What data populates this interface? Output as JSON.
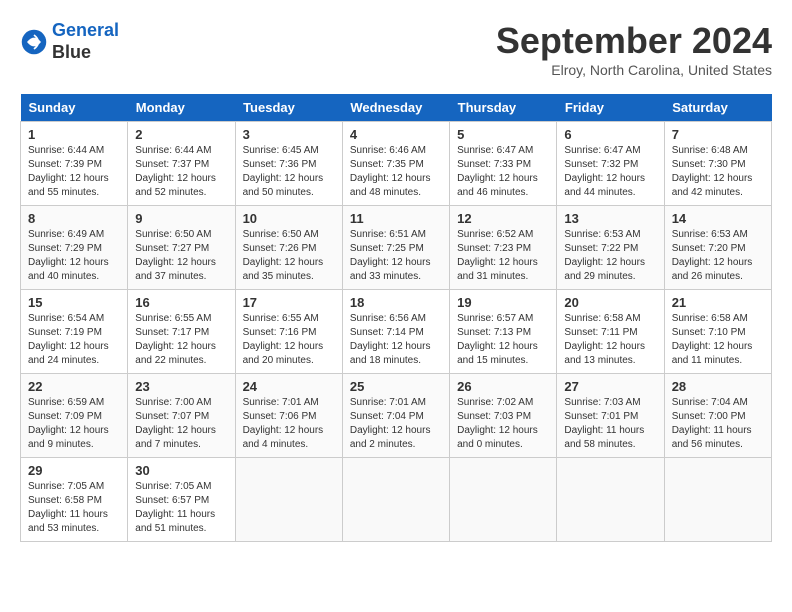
{
  "header": {
    "logo_line1": "General",
    "logo_line2": "Blue",
    "month": "September 2024",
    "location": "Elroy, North Carolina, United States"
  },
  "days_of_week": [
    "Sunday",
    "Monday",
    "Tuesday",
    "Wednesday",
    "Thursday",
    "Friday",
    "Saturday"
  ],
  "weeks": [
    [
      {
        "num": "1",
        "rise": "6:44 AM",
        "set": "7:39 PM",
        "hours": "12",
        "mins": "55"
      },
      {
        "num": "2",
        "rise": "6:44 AM",
        "set": "7:37 PM",
        "hours": "12",
        "mins": "52"
      },
      {
        "num": "3",
        "rise": "6:45 AM",
        "set": "7:36 PM",
        "hours": "12",
        "mins": "50"
      },
      {
        "num": "4",
        "rise": "6:46 AM",
        "set": "7:35 PM",
        "hours": "12",
        "mins": "48"
      },
      {
        "num": "5",
        "rise": "6:47 AM",
        "set": "7:33 PM",
        "hours": "12",
        "mins": "46"
      },
      {
        "num": "6",
        "rise": "6:47 AM",
        "set": "7:32 PM",
        "hours": "12",
        "mins": "44"
      },
      {
        "num": "7",
        "rise": "6:48 AM",
        "set": "7:30 PM",
        "hours": "12",
        "mins": "42"
      }
    ],
    [
      {
        "num": "8",
        "rise": "6:49 AM",
        "set": "7:29 PM",
        "hours": "12",
        "mins": "40"
      },
      {
        "num": "9",
        "rise": "6:50 AM",
        "set": "7:27 PM",
        "hours": "12",
        "mins": "37"
      },
      {
        "num": "10",
        "rise": "6:50 AM",
        "set": "7:26 PM",
        "hours": "12",
        "mins": "35"
      },
      {
        "num": "11",
        "rise": "6:51 AM",
        "set": "7:25 PM",
        "hours": "12",
        "mins": "33"
      },
      {
        "num": "12",
        "rise": "6:52 AM",
        "set": "7:23 PM",
        "hours": "12",
        "mins": "31"
      },
      {
        "num": "13",
        "rise": "6:53 AM",
        "set": "7:22 PM",
        "hours": "12",
        "mins": "29"
      },
      {
        "num": "14",
        "rise": "6:53 AM",
        "set": "7:20 PM",
        "hours": "12",
        "mins": "26"
      }
    ],
    [
      {
        "num": "15",
        "rise": "6:54 AM",
        "set": "7:19 PM",
        "hours": "12",
        "mins": "24"
      },
      {
        "num": "16",
        "rise": "6:55 AM",
        "set": "7:17 PM",
        "hours": "12",
        "mins": "22"
      },
      {
        "num": "17",
        "rise": "6:55 AM",
        "set": "7:16 PM",
        "hours": "12",
        "mins": "20"
      },
      {
        "num": "18",
        "rise": "6:56 AM",
        "set": "7:14 PM",
        "hours": "12",
        "mins": "18"
      },
      {
        "num": "19",
        "rise": "6:57 AM",
        "set": "7:13 PM",
        "hours": "12",
        "mins": "15"
      },
      {
        "num": "20",
        "rise": "6:58 AM",
        "set": "7:11 PM",
        "hours": "12",
        "mins": "13"
      },
      {
        "num": "21",
        "rise": "6:58 AM",
        "set": "7:10 PM",
        "hours": "12",
        "mins": "11"
      }
    ],
    [
      {
        "num": "22",
        "rise": "6:59 AM",
        "set": "7:09 PM",
        "hours": "12",
        "mins": "9"
      },
      {
        "num": "23",
        "rise": "7:00 AM",
        "set": "7:07 PM",
        "hours": "12",
        "mins": "7"
      },
      {
        "num": "24",
        "rise": "7:01 AM",
        "set": "7:06 PM",
        "hours": "12",
        "mins": "4"
      },
      {
        "num": "25",
        "rise": "7:01 AM",
        "set": "7:04 PM",
        "hours": "12",
        "mins": "2"
      },
      {
        "num": "26",
        "rise": "7:02 AM",
        "set": "7:03 PM",
        "hours": "12",
        "mins": "0"
      },
      {
        "num": "27",
        "rise": "7:03 AM",
        "set": "7:01 PM",
        "hours": "11",
        "mins": "58"
      },
      {
        "num": "28",
        "rise": "7:04 AM",
        "set": "7:00 PM",
        "hours": "11",
        "mins": "56"
      }
    ],
    [
      {
        "num": "29",
        "rise": "7:05 AM",
        "set": "6:58 PM",
        "hours": "11",
        "mins": "53"
      },
      {
        "num": "30",
        "rise": "7:05 AM",
        "set": "6:57 PM",
        "hours": "11",
        "mins": "51"
      },
      null,
      null,
      null,
      null,
      null
    ]
  ]
}
